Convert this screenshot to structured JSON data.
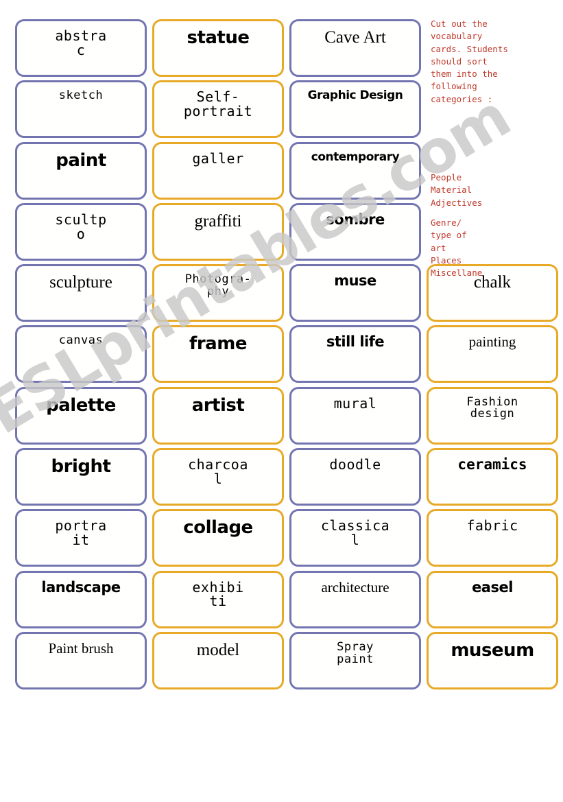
{
  "sheet": {
    "watermark": "ESLprintables.com",
    "colors": {
      "card_border_blue": "#7275b0",
      "card_border_orange": "#e8a927",
      "note_red": "#c0392b",
      "watermark_grey": "#c9c9c9",
      "page_background": "#ffffff"
    }
  },
  "notes": {
    "instructions": "Cut out the vocabulary cards. Students should sort them into the following categories :",
    "categories_group_1": "People\nMaterial\nAdjectives",
    "categories_group_2": "Genre/\ntype of\nart\nPlaces\nMiscellane"
  },
  "cards": [
    [
      {
        "label": "abstra c",
        "color": "blue",
        "font": "f-mono"
      },
      {
        "label": "statue",
        "color": "orange",
        "font": "f-round"
      },
      {
        "label": "Cave Art",
        "color": "blue",
        "font": "f-serif"
      },
      {
        "label": "",
        "color": "none",
        "font": ""
      }
    ],
    [
      {
        "label": "sketch",
        "color": "blue",
        "font": "f-mono-sm"
      },
      {
        "label": "Self- portrait",
        "color": "orange",
        "font": "f-mono"
      },
      {
        "label": "Graphic Design",
        "color": "blue",
        "font": "f-round-xs"
      },
      {
        "label": "",
        "color": "none",
        "font": ""
      }
    ],
    [
      {
        "label": "paint",
        "color": "blue",
        "font": "f-round"
      },
      {
        "label": "galler",
        "color": "orange",
        "font": "f-mono-lg"
      },
      {
        "label": "contemporary",
        "color": "blue",
        "font": "f-round-xs"
      },
      {
        "label": "",
        "color": "none",
        "font": ""
      }
    ],
    [
      {
        "label": "scultp o",
        "color": "blue",
        "font": "f-mono"
      },
      {
        "label": "graffiti",
        "color": "orange",
        "font": "f-serif"
      },
      {
        "label": "sombre",
        "color": "blue",
        "font": "f-round-sm"
      },
      {
        "label": "",
        "color": "none",
        "font": ""
      }
    ],
    [
      {
        "label": "sculpture",
        "color": "blue",
        "font": "f-serif"
      },
      {
        "label": "Photogra- phy",
        "color": "orange",
        "font": "f-mono-sm"
      },
      {
        "label": "muse",
        "color": "blue",
        "font": "f-round-sm"
      },
      {
        "label": "chalk",
        "color": "orange",
        "font": "f-serif"
      }
    ],
    [
      {
        "label": "canvas",
        "color": "blue",
        "font": "f-mono-sm"
      },
      {
        "label": "frame",
        "color": "orange",
        "font": "f-round"
      },
      {
        "label": "still life",
        "color": "blue",
        "font": "f-round-sm"
      },
      {
        "label": "painting",
        "color": "orange",
        "font": "f-serif-sm"
      }
    ],
    [
      {
        "label": "palette",
        "color": "blue",
        "font": "f-round"
      },
      {
        "label": "artist",
        "color": "orange",
        "font": "f-round"
      },
      {
        "label": "mural",
        "color": "blue",
        "font": "f-mono"
      },
      {
        "label": "Fashion design",
        "color": "orange",
        "font": "f-mono-sm"
      }
    ],
    [
      {
        "label": "bright",
        "color": "blue",
        "font": "f-round"
      },
      {
        "label": "charcoa l",
        "color": "orange",
        "font": "f-mono"
      },
      {
        "label": "doodle",
        "color": "blue",
        "font": "f-mono-lg"
      },
      {
        "label": "ceramics",
        "color": "orange",
        "font": "f-mono-b"
      }
    ],
    [
      {
        "label": "portra it",
        "color": "blue",
        "font": "f-mono"
      },
      {
        "label": "collage",
        "color": "orange",
        "font": "f-round"
      },
      {
        "label": "classica l",
        "color": "blue",
        "font": "f-mono"
      },
      {
        "label": "fabric",
        "color": "orange",
        "font": "f-mono-lg"
      }
    ],
    [
      {
        "label": "landscape",
        "color": "blue",
        "font": "f-round-sm"
      },
      {
        "label": "exhibi ti",
        "color": "orange",
        "font": "f-mono"
      },
      {
        "label": "architecture",
        "color": "blue",
        "font": "f-serif-sm"
      },
      {
        "label": "easel",
        "color": "orange",
        "font": "f-round-sm"
      }
    ],
    [
      {
        "label": "Paint brush",
        "color": "blue",
        "font": "f-serif-sm"
      },
      {
        "label": "model",
        "color": "orange",
        "font": "f-serif"
      },
      {
        "label": "Spray paint",
        "color": "blue",
        "font": "f-mono-sm"
      },
      {
        "label": "museum",
        "color": "orange",
        "font": "f-round"
      }
    ]
  ],
  "card_lines": [
    [
      [
        "abstra",
        "c"
      ],
      [
        "statue"
      ],
      [
        "Cave Art"
      ],
      []
    ],
    [
      [
        "sketch"
      ],
      [
        "Self-",
        "portrait"
      ],
      [
        "Graphic Design"
      ],
      []
    ],
    [
      [
        "paint"
      ],
      [
        "galler"
      ],
      [
        "contemporary"
      ],
      []
    ],
    [
      [
        "scultp",
        "o"
      ],
      [
        "graffiti"
      ],
      [
        "sombre"
      ],
      []
    ],
    [
      [
        "sculpture"
      ],
      [
        "Photogra-",
        "phy"
      ],
      [
        "muse"
      ],
      [
        "chalk"
      ]
    ],
    [
      [
        "canvas"
      ],
      [
        "frame"
      ],
      [
        "still life"
      ],
      [
        "painting"
      ]
    ],
    [
      [
        "palette"
      ],
      [
        "artist"
      ],
      [
        "mural"
      ],
      [
        "Fashion",
        "design"
      ]
    ],
    [
      [
        "bright"
      ],
      [
        "charcoa",
        "l"
      ],
      [
        "doodle"
      ],
      [
        "ceramics"
      ]
    ],
    [
      [
        "portra",
        "it"
      ],
      [
        "collage"
      ],
      [
        "classica",
        "l"
      ],
      [
        "fabric"
      ]
    ],
    [
      [
        "landscape"
      ],
      [
        "exhibi",
        "ti"
      ],
      [
        "architecture"
      ],
      [
        "easel"
      ]
    ],
    [
      [
        "Paint brush"
      ],
      [
        "model"
      ],
      [
        "Spray",
        "paint"
      ],
      [
        "museum"
      ]
    ]
  ]
}
